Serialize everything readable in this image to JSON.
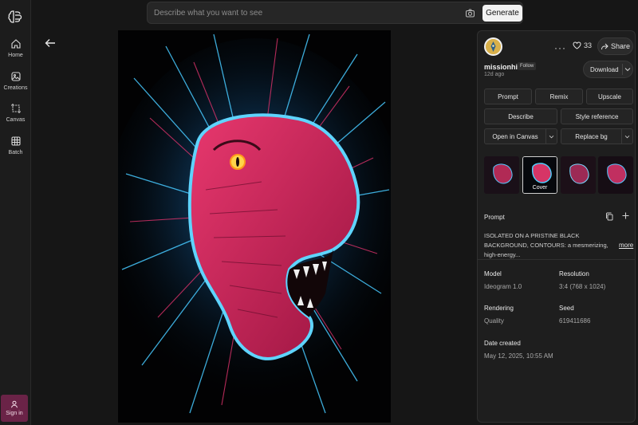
{
  "nav": {
    "items": [
      {
        "label": "Home",
        "icon": "home-icon"
      },
      {
        "label": "Creations",
        "icon": "image-icon"
      },
      {
        "label": "Canvas",
        "icon": "canvas-icon"
      },
      {
        "label": "Batch",
        "icon": "grid-icon"
      }
    ],
    "signin_label": "Sign in"
  },
  "search": {
    "placeholder": "Describe what you want to see",
    "value": "",
    "generate_label": "Generate"
  },
  "panel": {
    "username": "missionhill",
    "follow_label": "Follow",
    "time_ago": "12d ago",
    "like_count": "33",
    "share_label": "Share",
    "download_label": "Download",
    "actions": {
      "prompt": "Prompt",
      "remix": "Remix",
      "upscale": "Upscale",
      "describe": "Describe",
      "style_reference": "Style reference",
      "open_in_canvas": "Open in Canvas",
      "replace_bg": "Replace bg"
    },
    "cover_label": "Cover",
    "prompt_heading": "Prompt",
    "prompt_text": "ISOLATED ON A PRISTINE BLACK BACKGROUND, CONTOURS: a mesmerizing, high-energy...",
    "more_label": "more",
    "meta": {
      "model_label": "Model",
      "model_value": "Ideogram 1.0",
      "resolution_label": "Resolution",
      "resolution_value": "3:4 (768 x 1024)",
      "rendering_label": "Rendering",
      "rendering_value": "Quality",
      "seed_label": "Seed",
      "seed_value": "619411686",
      "date_label": "Date created",
      "date_value": "May 12, 2025, 10:55 AM"
    }
  },
  "colors": {
    "accent_neon_blue": "#3fc8ff",
    "accent_magenta": "#d8235e",
    "signin_bg": "#6a2347"
  }
}
